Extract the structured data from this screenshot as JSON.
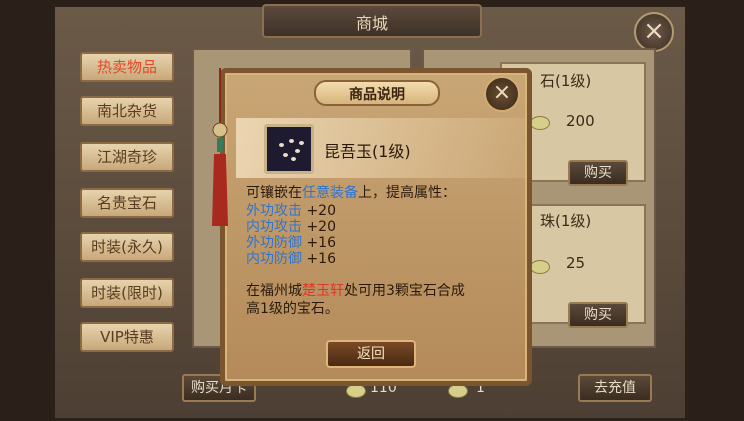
{
  "shop": {
    "title": "商城",
    "tabs": [
      {
        "label": "热卖物品"
      },
      {
        "label": "南北杂货"
      },
      {
        "label": "江湖奇珍"
      },
      {
        "label": "名贵宝石"
      },
      {
        "label": "时装(永久)"
      },
      {
        "label": "时装(限时)"
      },
      {
        "label": "VIP特惠"
      }
    ],
    "cards": [
      {
        "name": "石(1级)",
        "price": "200",
        "buy": "购买"
      },
      {
        "name": "珠(1级)",
        "price": "25",
        "buy": "购买"
      }
    ],
    "bottom": {
      "buy_left": "购买月卡",
      "gold": "110",
      "silver": "1",
      "recharge": "去充值"
    }
  },
  "dialog": {
    "title": "商品说明",
    "item_name": "昆吾玉(1级)",
    "desc_line1_a": "可镶嵌在",
    "desc_line1_b": "任意装备",
    "desc_line1_c": "上，提高属性：",
    "stats": [
      {
        "name": "外功攻击",
        "value": "+20"
      },
      {
        "name": "内功攻击",
        "value": "+20"
      },
      {
        "name": "外功防御",
        "value": "+16"
      },
      {
        "name": "内功防御",
        "value": "+16"
      }
    ],
    "note_a": "在福州城",
    "note_b": "楚玉轩",
    "note_c": "处可用3颗宝石合成",
    "note_line2": "高1级的宝石。",
    "back_label": "返回"
  },
  "colors": {
    "highlight_blue": "#2f74d0",
    "highlight_red": "#e0352a"
  }
}
